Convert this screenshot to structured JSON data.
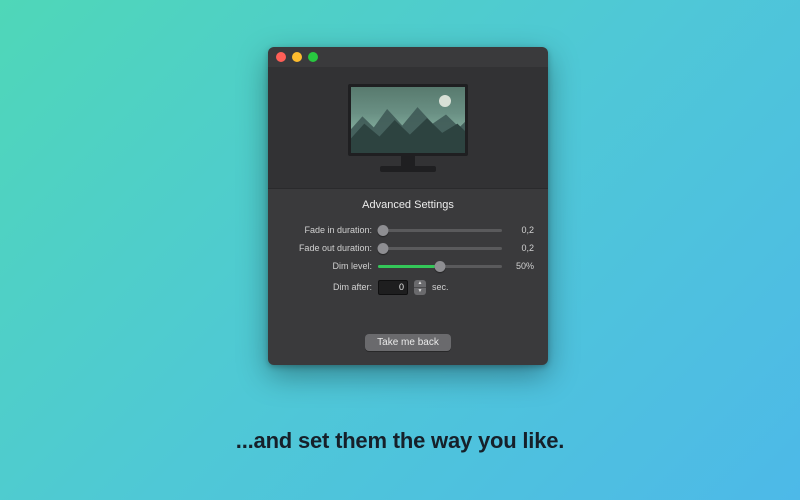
{
  "caption": "...and set them the way you like.",
  "window": {
    "traffic": {
      "close": "close",
      "minimize": "minimize",
      "zoom": "zoom"
    },
    "hero_icon": "monitor-wallpaper-icon"
  },
  "settings": {
    "title": "Advanced Settings",
    "fade_in": {
      "label": "Fade in duration:",
      "value_display": "0,2",
      "value_pct": 4
    },
    "fade_out": {
      "label": "Fade out duration:",
      "value_display": "0,2",
      "value_pct": 4
    },
    "dim_level": {
      "label": "Dim level:",
      "value_display": "50%",
      "value_pct": 50
    },
    "dim_after": {
      "label": "Dim after:",
      "value": "0",
      "unit": "sec."
    },
    "back_button": "Take me back"
  },
  "colors": {
    "accent": "#34c759",
    "window_bg": "#3a3a3c",
    "hero_bg": "#323234"
  }
}
